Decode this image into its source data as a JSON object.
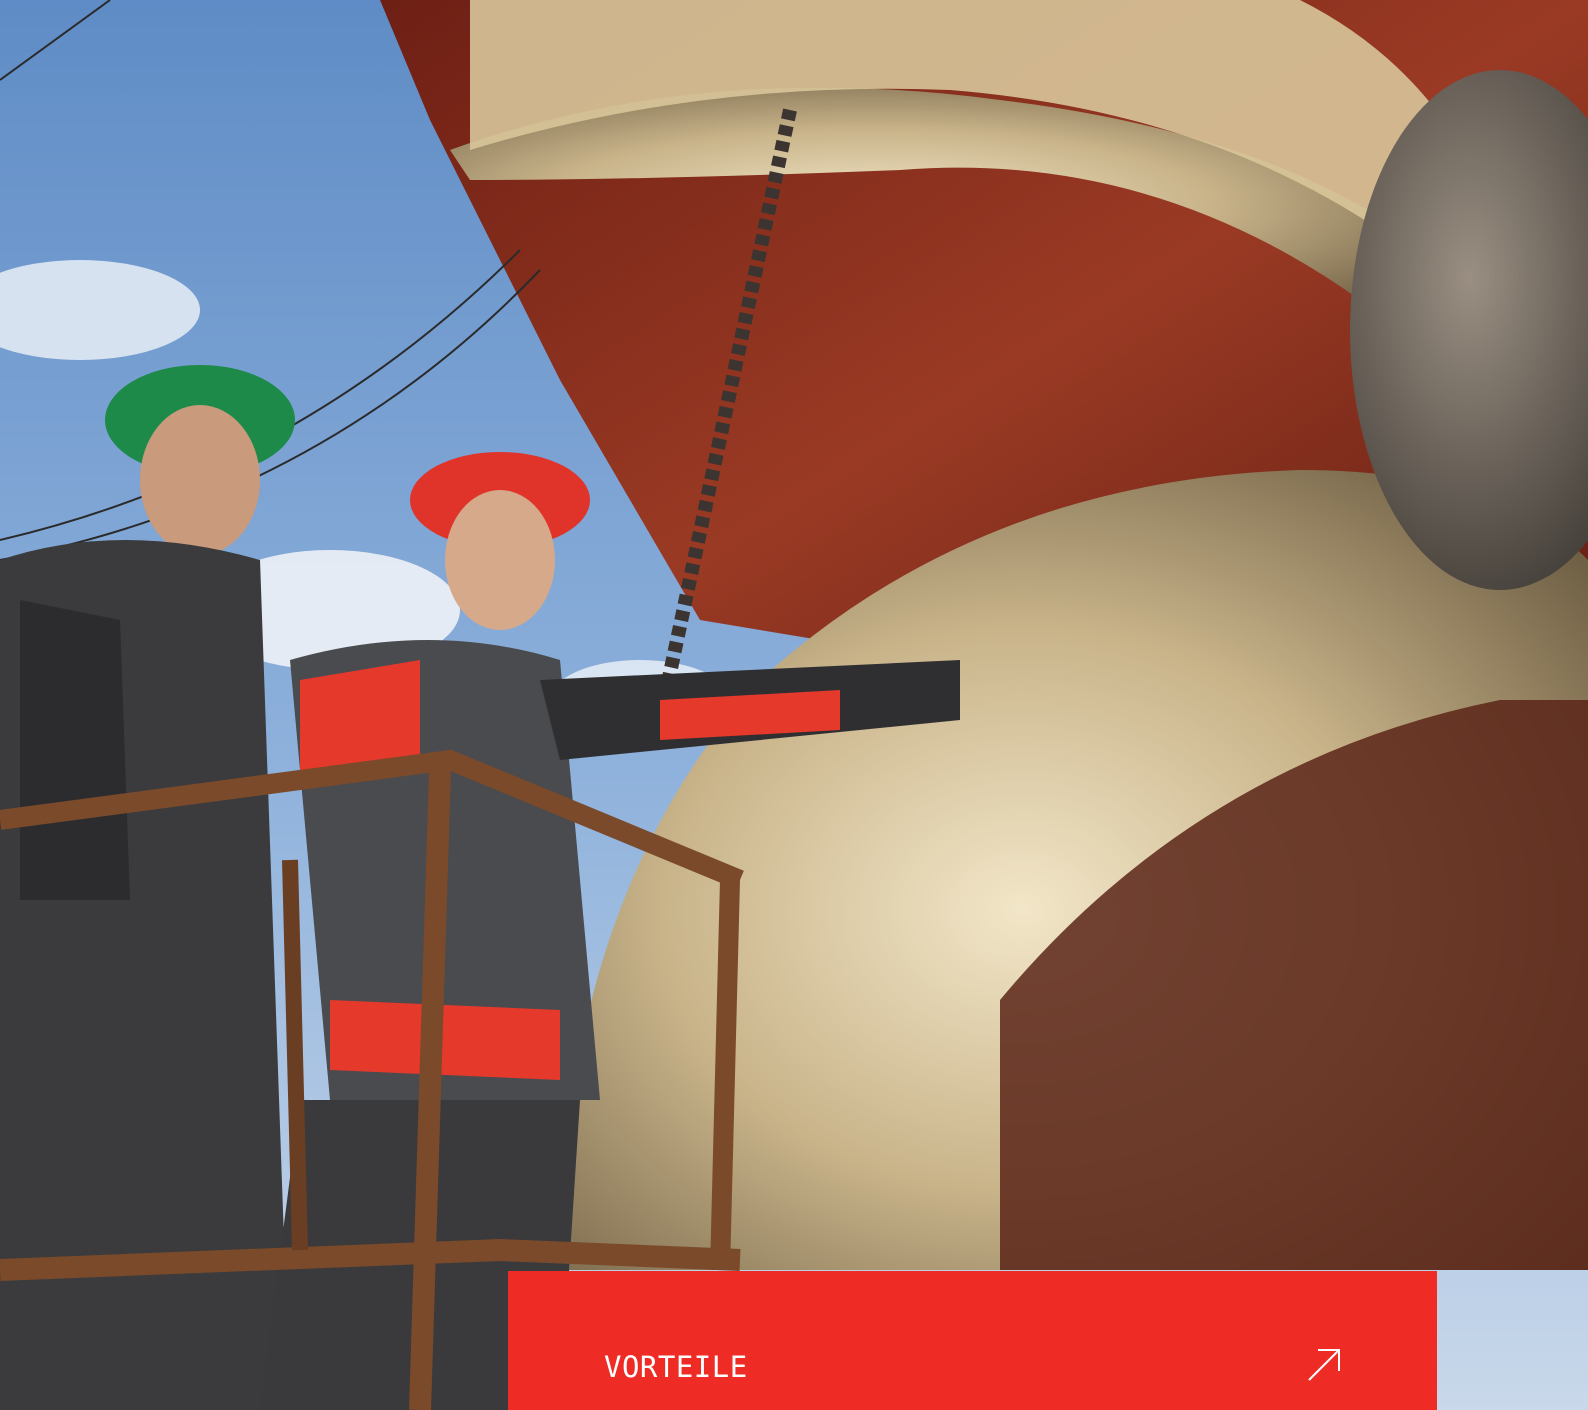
{
  "hero": {
    "image_icon": "photo-shipyard-workers-propeller",
    "colors": {
      "accent": "#ee2b24",
      "sky": "#6f98cf",
      "hull": "#8a2a1b",
      "propeller": "#c9b48a"
    }
  },
  "cta": {
    "label": "VORTEILE",
    "icon": "arrow-up-right-icon"
  }
}
